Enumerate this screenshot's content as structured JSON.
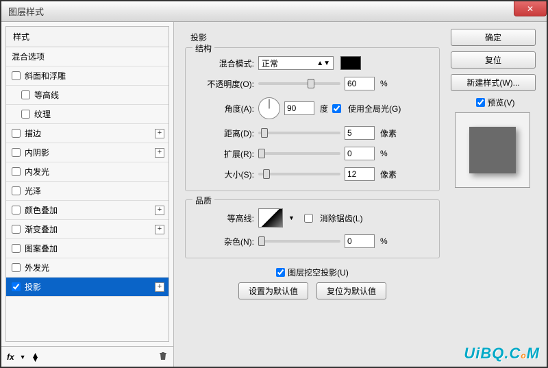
{
  "window": {
    "title": "图层样式",
    "close": "✕"
  },
  "sidebar": {
    "header": "样式",
    "blendOptions": "混合选项",
    "items": [
      {
        "label": "斜面和浮雕",
        "checked": false,
        "plus": false
      },
      {
        "label": "等高线",
        "checked": false,
        "plus": false,
        "indent": true
      },
      {
        "label": "纹理",
        "checked": false,
        "plus": false,
        "indent": true
      },
      {
        "label": "描边",
        "checked": false,
        "plus": true
      },
      {
        "label": "内阴影",
        "checked": false,
        "plus": true
      },
      {
        "label": "内发光",
        "checked": false,
        "plus": false
      },
      {
        "label": "光泽",
        "checked": false,
        "plus": false
      },
      {
        "label": "颜色叠加",
        "checked": false,
        "plus": true
      },
      {
        "label": "渐变叠加",
        "checked": false,
        "plus": true
      },
      {
        "label": "图案叠加",
        "checked": false,
        "plus": false
      },
      {
        "label": "外发光",
        "checked": false,
        "plus": false
      },
      {
        "label": "投影",
        "checked": true,
        "plus": true,
        "selected": true
      }
    ],
    "fx": "fx"
  },
  "panel": {
    "title": "投影",
    "structure": {
      "legend": "结构",
      "blendModeLabel": "混合模式:",
      "blendModeValue": "正常",
      "opacityLabel": "不透明度(O):",
      "opacityValue": "60",
      "opacityUnit": "%",
      "angleLabel": "角度(A):",
      "angleValue": "90",
      "angleUnit": "度",
      "globalLight": "使用全局光(G)",
      "distanceLabel": "距离(D):",
      "distanceValue": "5",
      "distanceUnit": "像素",
      "spreadLabel": "扩展(R):",
      "spreadValue": "0",
      "spreadUnit": "%",
      "sizeLabel": "大小(S):",
      "sizeValue": "12",
      "sizeUnit": "像素"
    },
    "quality": {
      "legend": "品质",
      "contourLabel": "等高线:",
      "antiAlias": "消除锯齿(L)",
      "noiseLabel": "杂色(N):",
      "noiseValue": "0",
      "noiseUnit": "%"
    },
    "knockout": "图层挖空投影(U)",
    "setDefault": "设置为默认值",
    "resetDefault": "复位为默认值"
  },
  "right": {
    "ok": "确定",
    "cancel": "复位",
    "newStyle": "新建样式(W)...",
    "preview": "预览(V)"
  },
  "watermark": "UiBQ.CoM"
}
